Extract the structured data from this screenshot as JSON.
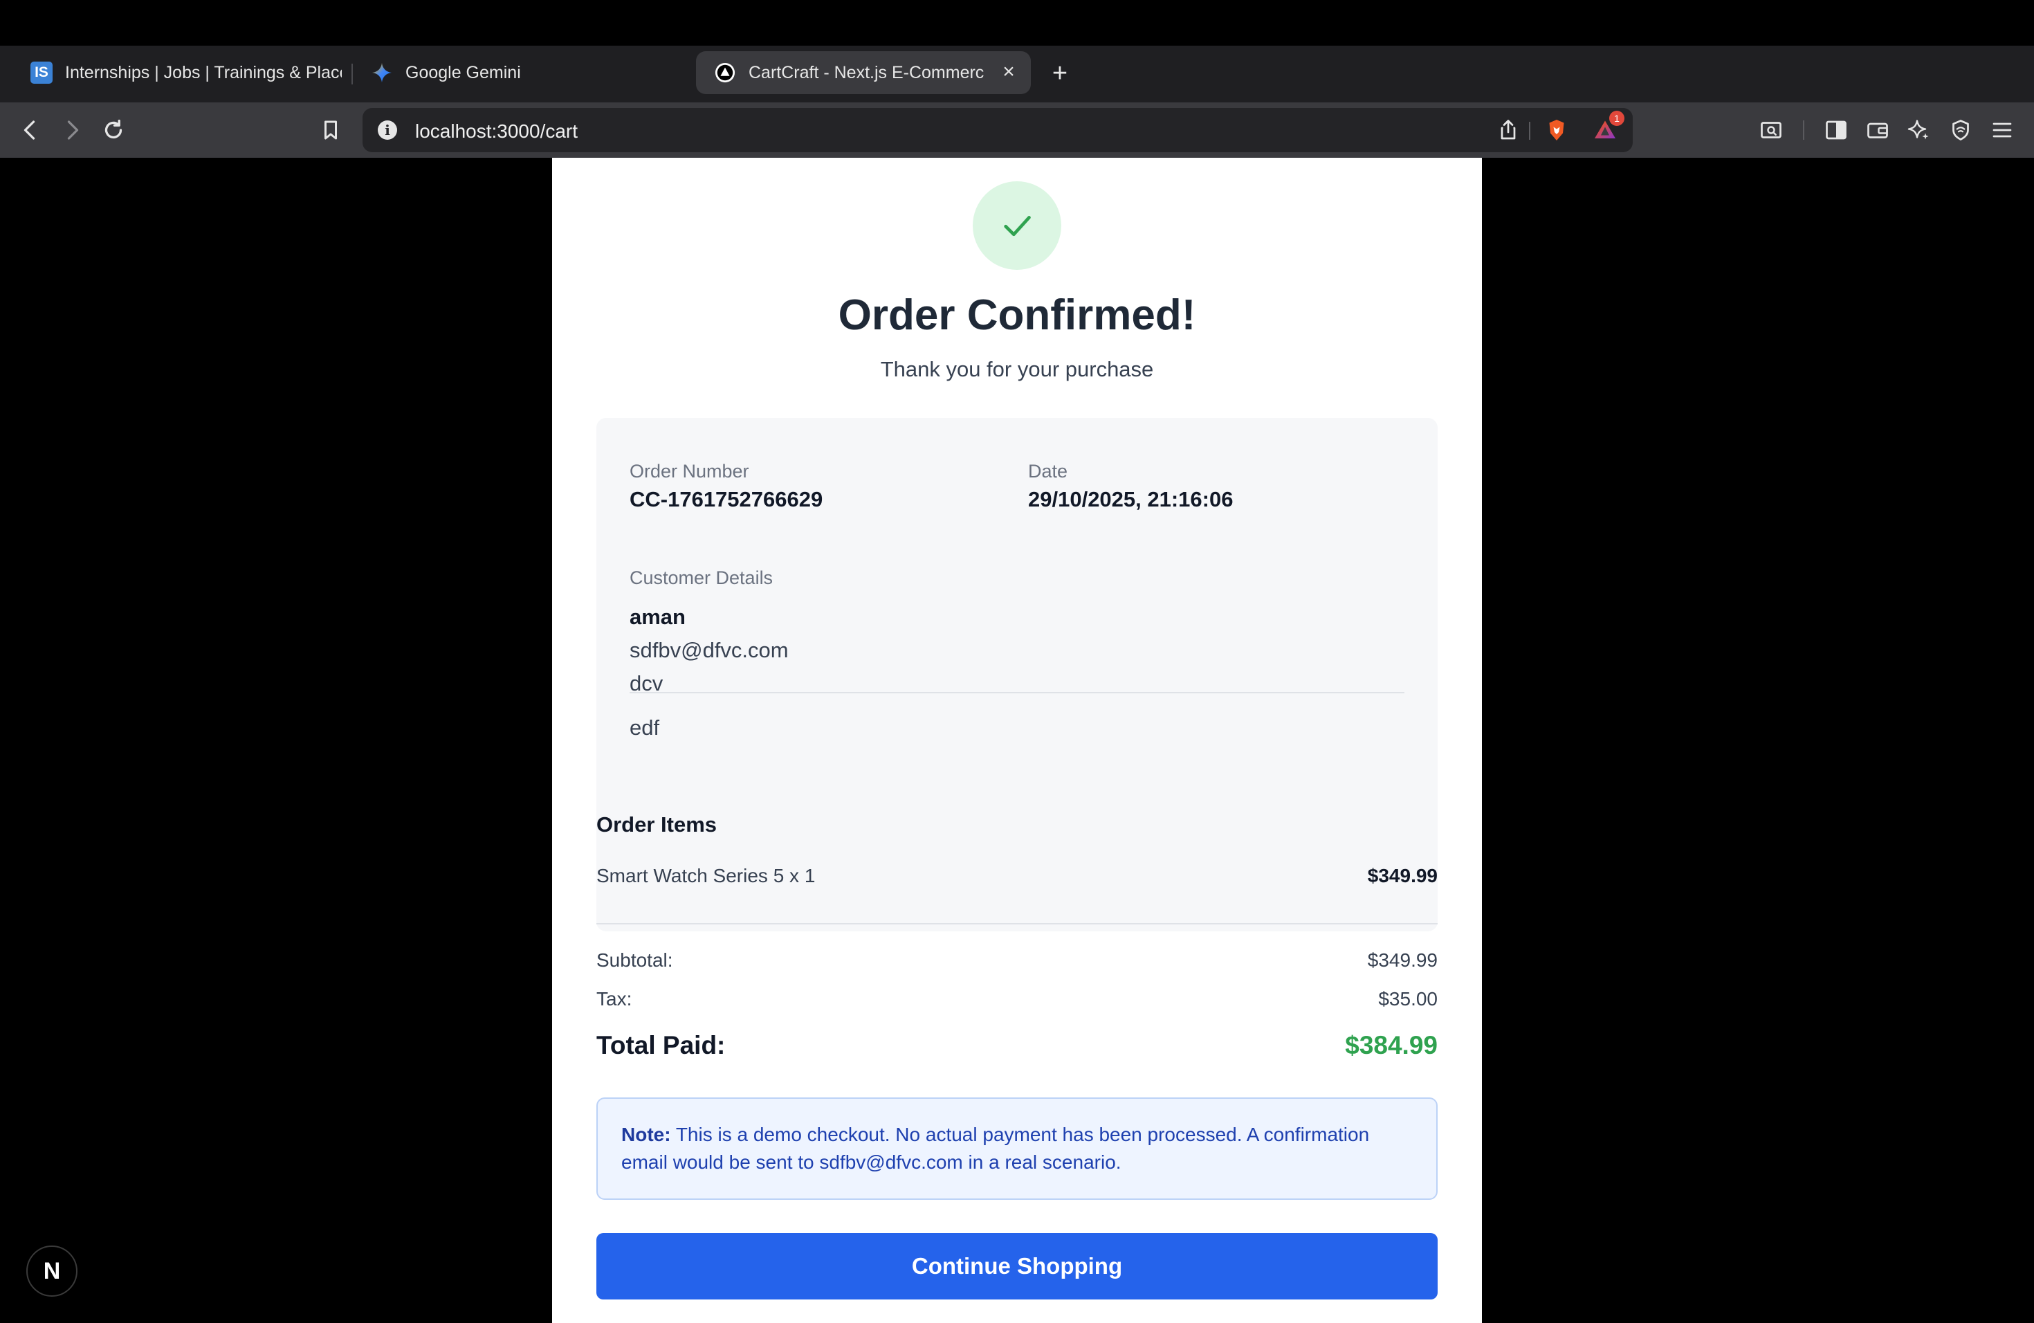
{
  "browser": {
    "tabs": [
      {
        "title": "Internships | Jobs | Trainings & Placements",
        "favicon": "internshala-logo-icon",
        "active": false
      },
      {
        "title": "Google Gemini",
        "favicon": "gemini-sparkle-icon",
        "active": false
      },
      {
        "title": "CartCraft - Next.js E-Commerce",
        "favicon": "vercel-triangle-icon",
        "active": true
      }
    ],
    "logo_text": "IS",
    "url": "localhost:3000/cart",
    "notification_count": "1"
  },
  "order": {
    "title": "Order Confirmed!",
    "subtitle": "Thank you for your purchase",
    "number_label": "Order Number",
    "number": "CC-1761752766629",
    "date_label": "Date",
    "date": "29/10/2025, 21:16:06",
    "customer_label": "Customer Details",
    "customer": {
      "name": "aman",
      "email": "sdfbv@dfvc.com",
      "line1": "dcv",
      "line2": "edf"
    },
    "items_label": "Order Items",
    "items": [
      {
        "name": "Smart Watch Series 5 x 1",
        "price": "$349.99"
      }
    ],
    "subtotal_label": "Subtotal:",
    "subtotal": "$349.99",
    "tax_label": "Tax:",
    "tax": "$35.00",
    "total_label": "Total Paid:",
    "total": "$384.99",
    "note_label": "Note:",
    "note_text": "This is a demo checkout. No actual payment has been processed. A confirmation email would be sent to sdfbv@dfvc.com in a real scenario.",
    "cta": "Continue Shopping"
  },
  "dev_badge": "N",
  "colors": {
    "accent": "#2563eb",
    "success": "#2fa24f",
    "success_bg": "#dcf6e3",
    "note_bg": "#eef4ff"
  }
}
